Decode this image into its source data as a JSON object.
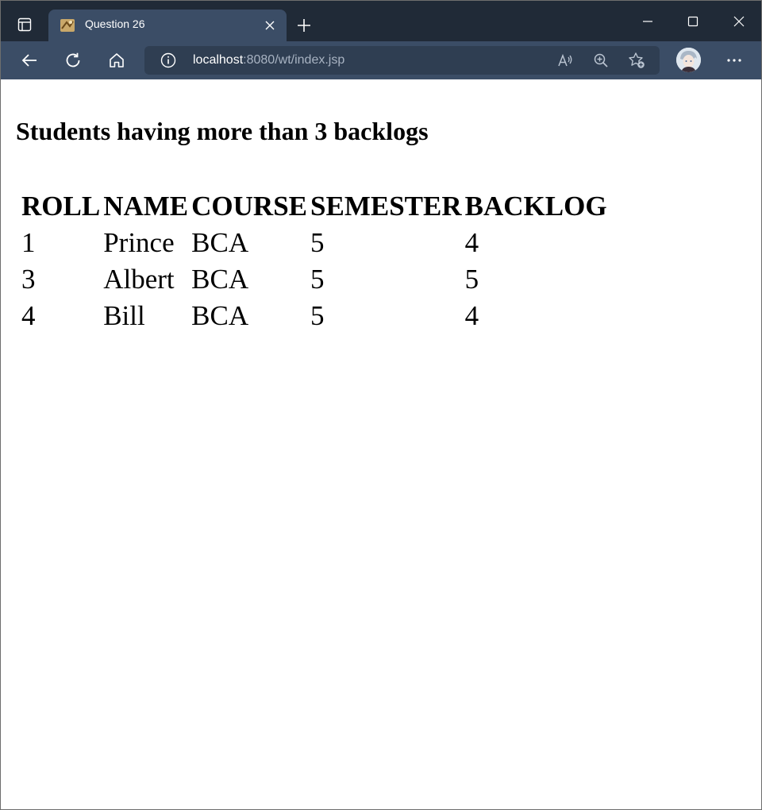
{
  "browser": {
    "tab": {
      "title": "Question 26"
    },
    "address": {
      "host": "localhost",
      "path": ":8080/wt/index.jsp"
    },
    "icons": {
      "tab_actions": "tab-actions-icon",
      "favicon": "favicon-icon",
      "close": "close-icon",
      "new_tab": "plus-icon",
      "minimize": "minimize-icon",
      "maximize": "maximize-icon",
      "window_close": "close-icon",
      "back": "arrow-left-icon",
      "refresh": "refresh-icon",
      "home": "home-icon",
      "info": "info-icon",
      "read_aloud": "read-aloud-icon",
      "zoom": "zoom-in-icon",
      "favorites": "add-favorite-icon",
      "profile": "avatar",
      "more": "more-icon"
    },
    "colors": {
      "tabstrip": "#202a37",
      "toolbar": "#3b4d66",
      "addressbar": "#2f3e52"
    }
  },
  "page": {
    "heading": "Students having more than 3 backlogs",
    "table": {
      "headers": [
        "ROLL",
        "NAME",
        "COURSE",
        "SEMESTER",
        "BACKLOG"
      ],
      "rows": [
        [
          "1",
          "Prince",
          "BCA",
          "5",
          "4"
        ],
        [
          "3",
          "Albert",
          "BCA",
          "5",
          "5"
        ],
        [
          "4",
          "Bill",
          "BCA",
          "5",
          "4"
        ]
      ]
    }
  }
}
